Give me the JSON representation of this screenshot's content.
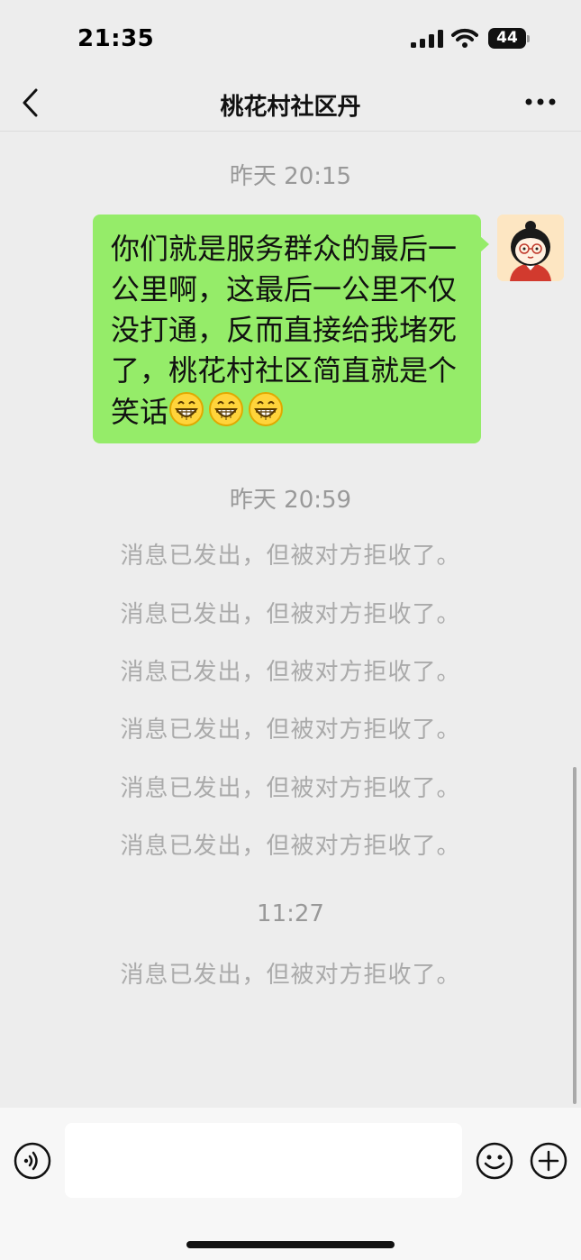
{
  "status_bar": {
    "time": "21:35",
    "battery": "44"
  },
  "header": {
    "title": "桃花村社区丹"
  },
  "messages": {
    "timestamp_1": "昨天 20:15",
    "bubble_text": "你们就是服务群众的最后一公里啊，这最后一公里不仅没打通，反而直接给我堵死了，桃花村社区简直就是个笑话",
    "emoji": "😁😁😁",
    "timestamp_2": "昨天 20:59",
    "rejected": [
      "消息已发出，但被对方拒收了。",
      "消息已发出，但被对方拒收了。",
      "消息已发出，但被对方拒收了。",
      "消息已发出，但被对方拒收了。",
      "消息已发出，但被对方拒收了。",
      "消息已发出，但被对方拒收了。"
    ],
    "timestamp_3": "11:27",
    "rejected_last": "消息已发出，但被对方拒收了。"
  },
  "input": {
    "placeholder": "",
    "value": ""
  },
  "icons": {
    "back": "chevron-left-icon",
    "more": "more-dots-icon",
    "voice": "voice-icon",
    "emoji": "smiley-icon",
    "plus": "plus-circle-icon"
  },
  "colors": {
    "bubble": "#95ec69",
    "background": "#ededed",
    "system_text": "#aaaaaa"
  }
}
